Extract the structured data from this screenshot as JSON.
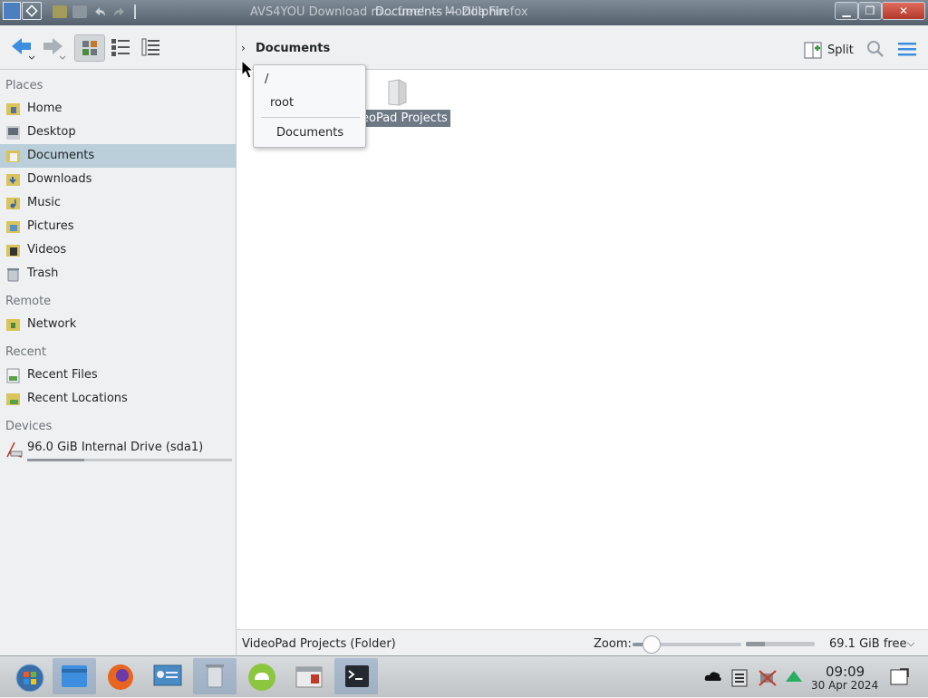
{
  "window": {
    "title_ghost": "AVS4YOU Download m... free! — Mozilla Firefox",
    "title": "Documents — Dolphin",
    "buttons": {
      "minimize": "▁",
      "maximize": "❐",
      "close": "✕"
    }
  },
  "toolbar": {
    "breadcrumb_arrow": "›",
    "breadcrumb": "Documents",
    "split_label": "Split",
    "icons": [
      "back-icon",
      "forward-icon",
      "icons-view-icon",
      "compact-view-icon",
      "details-view-icon",
      "split-icon",
      "search-icon",
      "menu-icon"
    ]
  },
  "sidebar": {
    "places_header": "Places",
    "places": [
      {
        "label": "Home"
      },
      {
        "label": "Desktop"
      },
      {
        "label": "Documents",
        "selected": true
      },
      {
        "label": "Downloads"
      },
      {
        "label": "Music"
      },
      {
        "label": "Pictures"
      },
      {
        "label": "Videos"
      },
      {
        "label": "Trash"
      }
    ],
    "remote_header": "Remote",
    "remote": [
      {
        "label": "Network"
      }
    ],
    "recent_header": "Recent",
    "recent": [
      {
        "label": "Recent Files"
      },
      {
        "label": "Recent Locations"
      }
    ],
    "devices_header": "Devices",
    "devices": [
      {
        "label": "96.0 GiB Internal Drive (sda1)",
        "used_fraction": 0.28
      }
    ]
  },
  "main": {
    "items": [
      {
        "label": "VideoPad Projects",
        "visible_label": "eoPad Projects",
        "type": "folder"
      }
    ]
  },
  "popup": {
    "items": [
      "/",
      "root",
      "Documents"
    ]
  },
  "statusbar": {
    "status_text": "VideoPad Projects (Folder)",
    "zoom_label": "Zoom:",
    "zoom_fraction": 0.1,
    "space_fraction": 0.28,
    "free_text": "69.1 GiB free",
    "chevron": "⌵"
  },
  "taskbar": {
    "apps": [
      "start-menu",
      "file-manager",
      "firefox",
      "control-center",
      "trash",
      "cloud-sync",
      "software-store",
      "terminal"
    ],
    "time": "09:09",
    "date": "30 Apr 2024"
  },
  "colors": {
    "selection": "#bacfda",
    "accent": "#3d8ede",
    "titlebar": "#5b6772"
  }
}
